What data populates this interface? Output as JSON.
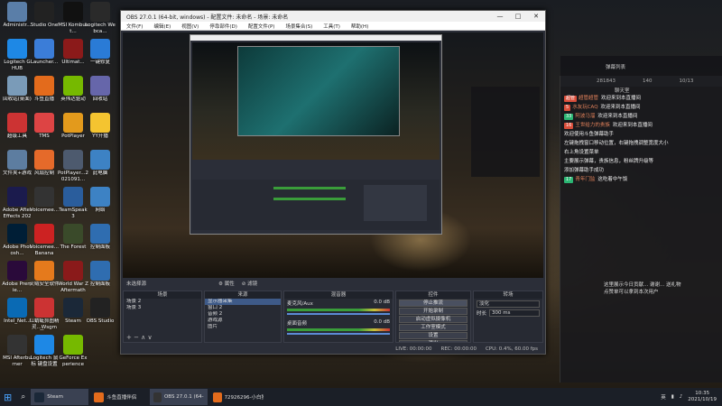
{
  "desktop_icons": [
    {
      "label": "Administr...",
      "color": "#5a7ea8"
    },
    {
      "label": "Studio One",
      "color": "#222"
    },
    {
      "label": "MSI Kombust...",
      "color": "#111"
    },
    {
      "label": "Logitech Webca...",
      "color": "#2a2a2a"
    },
    {
      "label": "Logitech G HUB",
      "color": "#1e88e5"
    },
    {
      "label": "Launcher...",
      "color": "#3b7dd8"
    },
    {
      "label": "Ultimat...",
      "color": "#8b1a1a"
    },
    {
      "label": "一键修复",
      "color": "#2a7bd6"
    },
    {
      "label": "回收站(桌面)",
      "color": "#7a9bb8"
    },
    {
      "label": "斗鱼直播",
      "color": "#e36b1c"
    },
    {
      "label": "英伟达驱动",
      "color": "#76b900"
    },
    {
      "label": "回收站",
      "color": "#66a"
    },
    {
      "label": "超级工具",
      "color": "#c33"
    },
    {
      "label": "TMS",
      "color": "#d44"
    },
    {
      "label": "PotPlayer",
      "color": "#e39a1c"
    },
    {
      "label": "YY开播",
      "color": "#f4c430"
    },
    {
      "label": "文件夹+游戏",
      "color": "#5d7da0"
    },
    {
      "label": "风扇控制",
      "color": "#e56a2a"
    },
    {
      "label": "PotPlayer...2021091...",
      "color": "#4d5a6e"
    },
    {
      "label": "此电脑",
      "color": "#3d82c4"
    },
    {
      "label": "Adobe After Effects 2020",
      "color": "#1b1b4d"
    },
    {
      "label": "Voicemee...",
      "color": "#333"
    },
    {
      "label": "TeamSpeak 3",
      "color": "#2a5d9c"
    },
    {
      "label": "网络",
      "color": "#3d82c4"
    },
    {
      "label": "Adobe Photosh...",
      "color": "#001e36"
    },
    {
      "label": "Voicemee... Banana",
      "color": "#c22"
    },
    {
      "label": "The Forest",
      "color": "#3a4a2a"
    },
    {
      "label": "控制面板",
      "color": "#2f6db0"
    },
    {
      "label": "Adobe Premie...",
      "color": "#2a0a3a"
    },
    {
      "label": "火绒安全软件",
      "color": "#e57a1c"
    },
    {
      "label": "World War Z Aftermath",
      "color": "#8a1a1a"
    },
    {
      "label": "控制面板",
      "color": "#2f6db0"
    },
    {
      "label": "Intel_Net...",
      "color": "#0a6ab4"
    },
    {
      "label": "红蜻蜓抓图精灵...Wsgm (无...)",
      "color": "#c33"
    },
    {
      "label": "Steam",
      "color": "#1b2838"
    },
    {
      "label": "OBS Studio",
      "color": "#222"
    },
    {
      "label": "MSI Afterburner",
      "color": "#333"
    },
    {
      "label": "Logitech 鼠标 键盘设置",
      "color": "#1e88e5"
    },
    {
      "label": "GeForce Experience",
      "color": "#76b900"
    }
  ],
  "obs": {
    "title": "OBS 27.0.1 (64-bit, windows) - 配置文件: 未命名 - 场景: 未命名",
    "window_controls": [
      "—",
      "□",
      "✕"
    ],
    "menu": [
      "文件(F)",
      "编辑(E)",
      "视图(V)",
      "停靠部件(D)",
      "配置文件(P)",
      "场景集合(S)",
      "工具(T)",
      "帮助(H)"
    ],
    "scenebar_label": "未选择源",
    "scene_tabs": [
      "属性",
      "滤镜"
    ],
    "docks": {
      "scenes_title": "场景",
      "scenes": [
        "场景 2",
        "场景 3"
      ],
      "sources_title": "来源",
      "sources": [
        "显示器采集",
        "窗口 2",
        "音频 2",
        "游戏源",
        "图片"
      ],
      "mixer_title": "混音器",
      "mixer": [
        {
          "name": "麦克风/Aux",
          "db": "0.0 dB"
        },
        {
          "name": "桌面音频",
          "db": "0.0 dB"
        }
      ],
      "transitions_title": "转场",
      "controls_title": "控件",
      "controls": [
        "停止推流",
        "开始录制",
        "启动虚拟摄像机",
        "工作室模式",
        "设置",
        "退出"
      ],
      "transition_type": "淡化",
      "duration_label": "时长",
      "duration_value": "300 ms"
    },
    "status": {
      "live": "LIVE: 00:00:00",
      "rec": "REC: 00:00:00",
      "cpu": "CPU: 0.4%, 60.00 fps"
    }
  },
  "chat": {
    "header": "弹幕列表",
    "stats": [
      "281843",
      "140",
      "10/13"
    ],
    "tab": "聊天室",
    "messages": [
      {
        "badge": "超管",
        "badge_color": "#d94d3a",
        "user": "超管超管",
        "text": "欢迎来到本直播间"
      },
      {
        "badge": "5",
        "badge_color": "#d94d3a",
        "user": "水友玩CAQ",
        "text": "欢迎来到本直播间"
      },
      {
        "badge": "33",
        "badge_color": "#2bb673",
        "user": "阿波马溜",
        "text": "欢迎来到本直播间"
      },
      {
        "badge": "16",
        "badge_color": "#d94d3a",
        "user": "王世给力的贵族",
        "text": "欢迎来到本直播间"
      },
      {
        "badge": "",
        "badge_color": "",
        "user": "",
        "text": "欢迎使用斗鱼弹幕助手"
      },
      {
        "badge": "",
        "badge_color": "",
        "user": "",
        "text": "左键拖拽窗口移动位置，右键拖拽调整宽度大小"
      },
      {
        "badge": "",
        "badge_color": "",
        "user": "",
        "text": "右上角设置菜单"
      },
      {
        "badge": "",
        "badge_color": "",
        "user": "",
        "text": "主要展示弹幕，贵族信息，粉丝牌升级等"
      },
      {
        "badge": "",
        "badge_color": "",
        "user": "",
        "text": "添加弹幕助手成功"
      },
      {
        "badge": "17",
        "badge_color": "#2bb673",
        "user": "青年门监",
        "text": "这吃着中午饭"
      }
    ],
    "footer": [
      "这里展示今日贡献... 谢谢... 送礼物",
      "点赞单可以拿到本次用户"
    ]
  },
  "taskbar": {
    "items": [
      {
        "label": "Steam",
        "color": "#1b2838",
        "active": true
      },
      {
        "label": "斗鱼直播伴侣",
        "color": "#e36b1c",
        "active": false
      },
      {
        "label": "OBS 27.0.1 (64-bit...",
        "color": "#333",
        "active": true
      },
      {
        "label": "72926296-小白独...",
        "color": "#e36b1c",
        "active": false
      }
    ],
    "tray_text": "英",
    "time": "10:35",
    "date": "2021/10/19"
  }
}
